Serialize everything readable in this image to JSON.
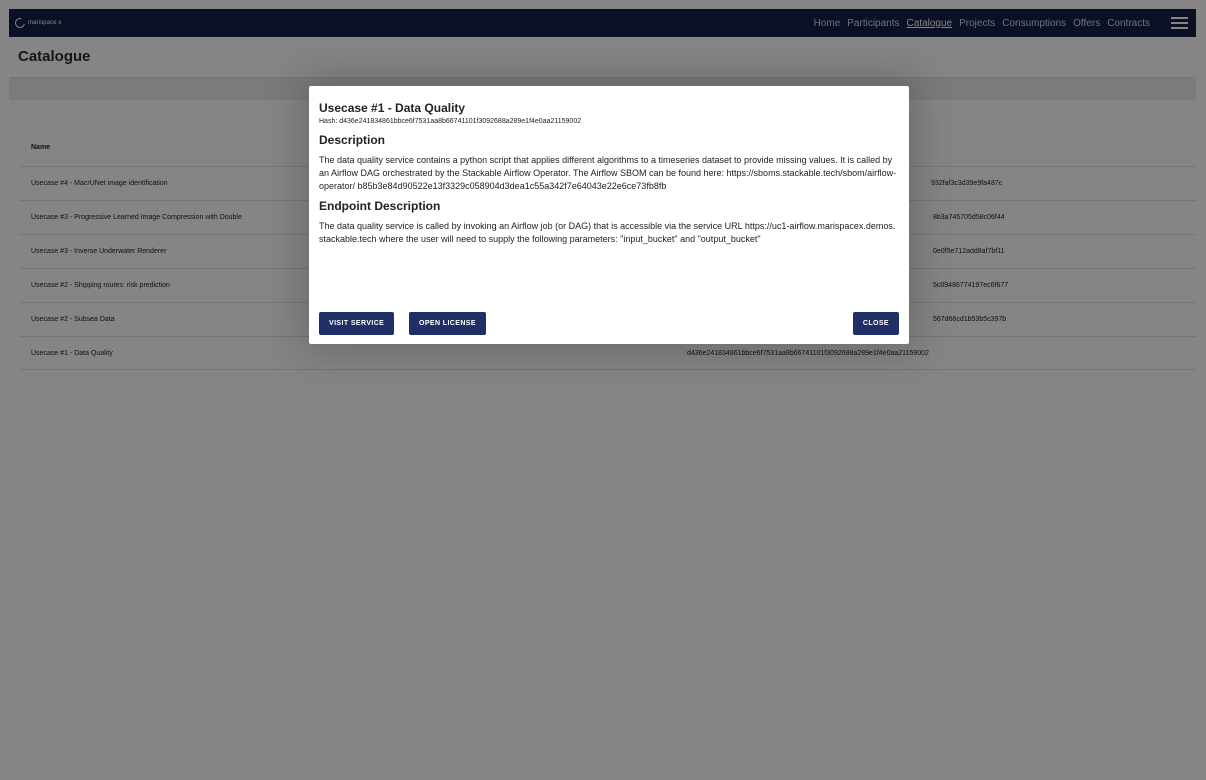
{
  "topbar": {
    "logo_text": "marispace x",
    "nav": [
      {
        "label": "Home"
      },
      {
        "label": "Participants"
      },
      {
        "label": "Catalogue",
        "active": true
      },
      {
        "label": "Projects"
      },
      {
        "label": "Consumptions"
      },
      {
        "label": "Offers"
      },
      {
        "label": "Contracts"
      }
    ],
    "menu_icon": "hamburger-menu-icon"
  },
  "page": {
    "title": "Catalogue"
  },
  "table": {
    "columns": [
      "Name"
    ],
    "rows": [
      {
        "name": "Usecase #4 - MacrUNet image identification",
        "hash": "932faf3c3d39e9fa487c"
      },
      {
        "name": "Usecase #3 - Progressive Learned Image Compression with Double",
        "hash": "8b3a745705d58c06f44"
      },
      {
        "name": "Usecase #3 - Inverse Underwater Renderer",
        "hash": "0e0f5e712add8af7bf11"
      },
      {
        "name": "Usecase #2 - Shipping routes: risk prediction",
        "hash": "5c09486774197ec6f677"
      },
      {
        "name": "Usecase #2 - Subsea Data",
        "hash": "567d66cd1b53b5c397b"
      },
      {
        "name": "Usecase #1 - Data Quality",
        "hash": "d436e241834861bbce6f7531aa8b66741101f3092688a289e1f4e0aa21159002"
      }
    ]
  },
  "modal": {
    "title": "Usecase #1 - Data Quality",
    "hash_line": "Hash: d436e241834861bbce6f7531aa8b66741101f3092688a289e1f4e0aa21159002",
    "description_heading": "Description",
    "description_text": "The data quality service contains a python script that applies different algorithms to a timeseries dataset to provide missing values. It is called by an Airflow DAG orchestrated by the Stackable Airflow Operator. The Airflow SBOM can be found here: https://sboms.stackable.tech/sbom/airflow-operator/ b85b3e84d90522e13f3329c058904d3dea1c55a342f7e64043e22e6ce73fb8fb",
    "endpoint_heading": "Endpoint Description",
    "endpoint_text": "The data quality service is called by invoking an Airflow job (or DAG) that is accessible via the service URL https://uc1-airflow.marispacex.demos.stackable.tech where the user will need to supply the following parameters: \"input_bucket\" and \"output_bucket\"",
    "buttons": {
      "visit": "VISIT SERVICE",
      "license": "OPEN LICENSE",
      "close": "CLOSE"
    }
  },
  "colors": {
    "topbar": "#171f45",
    "button": "#203067"
  }
}
